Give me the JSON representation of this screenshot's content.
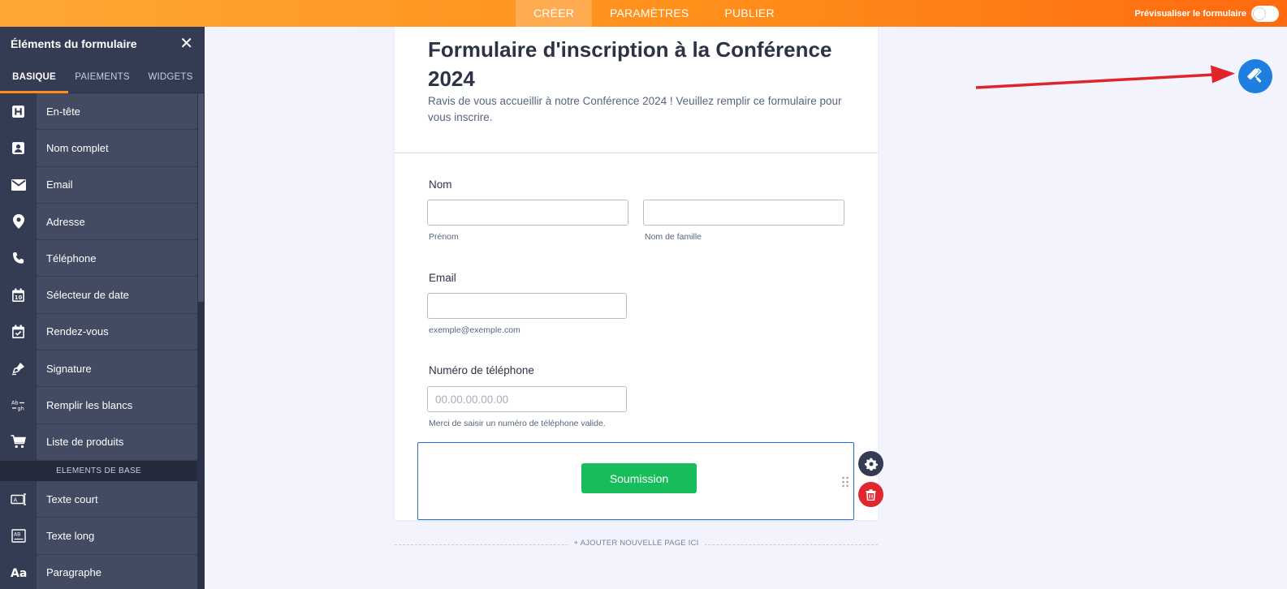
{
  "topbar": {
    "tabs": [
      {
        "label": "CRÉER",
        "active": true
      },
      {
        "label": "PARAMÈTRES",
        "active": false
      },
      {
        "label": "PUBLIER",
        "active": false
      }
    ],
    "preview_label": "Prévisualiser le formulaire",
    "preview_enabled": false
  },
  "sidebar": {
    "title": "Éléments du formulaire",
    "tabs": [
      {
        "label": "BASIQUE",
        "active": true
      },
      {
        "label": "PAIEMENTS",
        "active": false
      },
      {
        "label": "WIDGETS",
        "active": false
      }
    ],
    "items": [
      {
        "label": "En-tête",
        "icon": "heading-icon"
      },
      {
        "label": "Nom complet",
        "icon": "contact-card-icon"
      },
      {
        "label": "Email",
        "icon": "envelope-icon"
      },
      {
        "label": "Adresse",
        "icon": "map-pin-icon"
      },
      {
        "label": "Téléphone",
        "icon": "phone-icon"
      },
      {
        "label": "Sélecteur de date",
        "icon": "calendar-icon"
      },
      {
        "label": "Rendez-vous",
        "icon": "calendar-check-icon"
      },
      {
        "label": "Signature",
        "icon": "pen-nib-icon"
      },
      {
        "label": "Remplir les blancs",
        "icon": "fill-blanks-icon"
      },
      {
        "label": "Liste de produits",
        "icon": "cart-icon"
      }
    ],
    "section_label": "ELEMENTS DE BASE",
    "basic_items": [
      {
        "label": "Texte court",
        "icon": "short-text-icon"
      },
      {
        "label": "Texte long",
        "icon": "long-text-icon"
      },
      {
        "label": "Paragraphe",
        "icon": "paragraph-icon"
      }
    ]
  },
  "form": {
    "title": "Formulaire d'inscription à la Conférence 2024",
    "subtitle": "Ravis de vous accueillir à notre Conférence 2024 ! Veuillez remplir ce formulaire pour vous inscrire.",
    "name_label": "Nom",
    "first_name_value": "",
    "first_name_sublabel": "Prénom",
    "last_name_value": "",
    "last_name_sublabel": "Nom de famille",
    "email_label": "Email",
    "email_value": "",
    "email_sublabel": "exemple@exemple.com",
    "phone_label": "Numéro de téléphone",
    "phone_placeholder": "00.00.00.00.00",
    "phone_sublabel": "Merci de saisir un numéro de téléphone valide.",
    "submit_label": "Soumission",
    "add_page_label": "+ AJOUTER NOUVELLE PAGE ICI"
  },
  "colors": {
    "accent": "#ff8c1a",
    "submit": "#18bd5b",
    "selection": "#1f71d9",
    "delete": "#e0272f",
    "designer": "#1f7fe0",
    "arrow": "#e0242a"
  }
}
